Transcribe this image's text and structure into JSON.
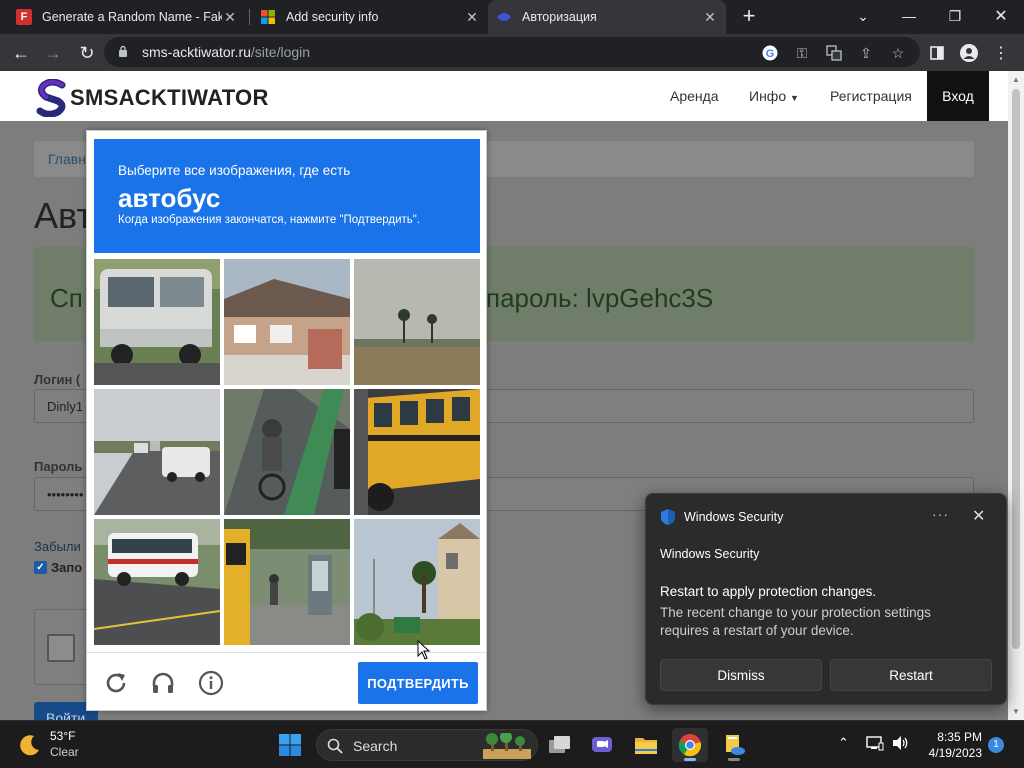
{
  "browser": {
    "tabs": [
      {
        "title": "Generate a Random Name - Fake",
        "icon": "fakename-favicon"
      },
      {
        "title": "Add security info",
        "icon": "microsoft-favicon"
      },
      {
        "title": "Авторизация",
        "icon": "smsactiwator-favicon"
      }
    ],
    "url_host": "sms-acktiwator.ru",
    "url_path": "/site/login"
  },
  "site": {
    "logo_text": "SMSACKTIWATOR",
    "nav": [
      "Аренда",
      "Инфо",
      "Регистрация",
      "Вход"
    ],
    "breadcrumb": "Главн",
    "page_title": "Авт",
    "alert_left": "Сп",
    "alert_right": "пароль: lvpGehc3S",
    "login_label": "Логин (",
    "login_value": "Dinly1",
    "password_label": "Пароль",
    "password_value": "••••••••",
    "forgot_link": "Забыли",
    "remember_label": "Запо",
    "submit_label": "Войти"
  },
  "captcha": {
    "instruction": "Выберите все изображения, где есть",
    "target": "автобус",
    "hint": "Когда изображения закончатся, нажмите \"Подтвердить\".",
    "verify_label": "ПОДТВЕРДИТЬ",
    "icons": [
      "reload-icon",
      "audio-icon",
      "info-icon"
    ]
  },
  "toast": {
    "app": "Windows Security",
    "header": "Windows Security",
    "title": "Restart to apply protection changes.",
    "body": "The recent change to your protection settings requires a restart of your device.",
    "dismiss": "Dismiss",
    "restart": "Restart"
  },
  "taskbar": {
    "temp": "53°F",
    "condition": "Clear",
    "search": "Search",
    "time": "8:35 PM",
    "date": "4/19/2023",
    "notifications": "1"
  },
  "colors": {
    "captcha_blue": "#1a73e8",
    "chrome_dark": "#202124",
    "toast_bg": "#2b2b2b"
  }
}
